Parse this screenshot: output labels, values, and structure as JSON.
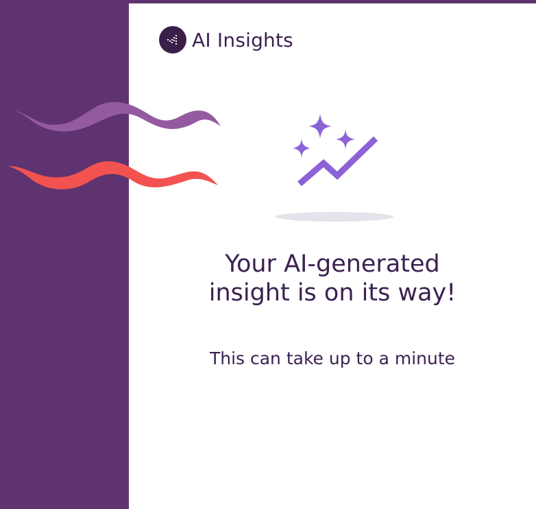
{
  "app": {
    "title": "AI Insights",
    "logo_icon": "ai-insights-logo-icon"
  },
  "status": {
    "heading": "Your AI-generated\ninsight is on its way!",
    "subtext": "This can take up to a minute",
    "illustration_icon": "sparkle-trend-icon"
  },
  "colors": {
    "sidebar": "#5f3370",
    "text": "#3b2151",
    "accent": "#8b63d6",
    "wave_purple": "#935aa0",
    "wave_red": "#f25350"
  }
}
